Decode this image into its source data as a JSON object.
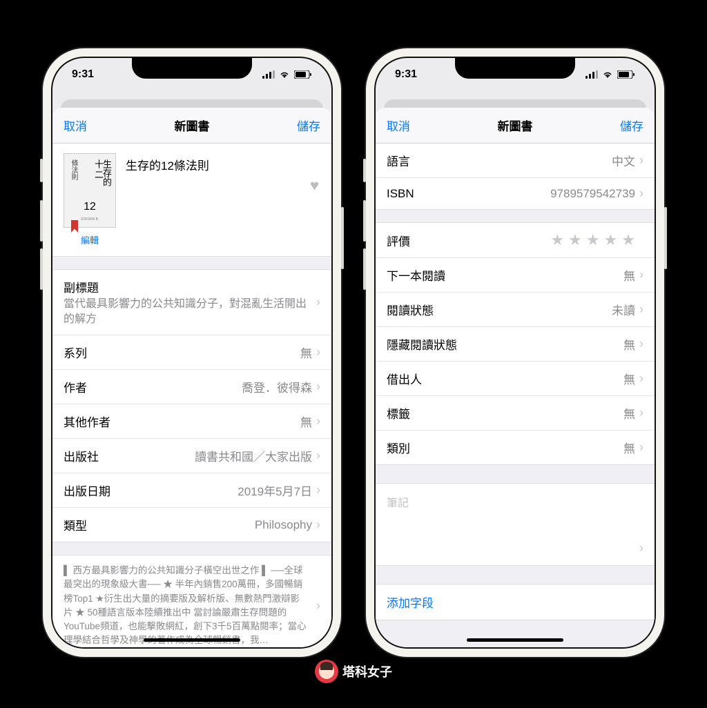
{
  "status": {
    "time": "9:31"
  },
  "nav": {
    "cancel": "取消",
    "title": "新圖書",
    "save": "儲存"
  },
  "book": {
    "title": "生存的12條法則",
    "edit_label": "編輯",
    "cover_text": {
      "big1": "十二",
      "big2": "生存的",
      "left": "條法則",
      "num": "12",
      "author": "JORDAN B."
    }
  },
  "left_rows": {
    "subtitle_label": "副標題",
    "subtitle_value": "當代最具影響力的公共知識分子，對混亂生活開出的解方",
    "series_label": "系列",
    "series_value": "無",
    "author_label": "作者",
    "author_value": "喬登．彼得森",
    "other_authors_label": "其他作者",
    "other_authors_value": "無",
    "publisher_label": "出版社",
    "publisher_value": "讀書共和國／大家出版",
    "pubdate_label": "出版日期",
    "pubdate_value": "2019年5月7日",
    "genre_label": "類型",
    "genre_value": "Philosophy"
  },
  "description": "▌ 西方最具影響力的公共知識分子橫空出世之作 ▌   ──全球最突出的現象級大書── ★ 半年內銷售200萬冊，多國暢銷榜Top1 ★衍生出大量的摘要版及解析版、無數熱門激辯影片 ★ 50種語言版本陸續推出中   當討論嚴肅生存問題的YouTube頻道，也能擊敗網紅，創下3千5百萬點閱率；當心理學結合哲學及神學的著作成為全球暢銷書，我…",
  "right_rows": {
    "language_label": "語言",
    "language_value": "中文",
    "isbn_label": "ISBN",
    "isbn_value": "9789579542739",
    "rating_label": "評價",
    "next_read_label": "下一本閱讀",
    "next_read_value": "無",
    "status_label": "閱讀狀態",
    "status_value": "未讀",
    "hide_status_label": "隱藏閱讀狀態",
    "hide_status_value": "無",
    "lent_label": "借出人",
    "lent_value": "無",
    "tags_label": "標籤",
    "tags_value": "無",
    "category_label": "類別",
    "category_value": "無"
  },
  "notes_placeholder": "筆記",
  "add_field_label": "添加字段",
  "watermark": "塔科女子"
}
